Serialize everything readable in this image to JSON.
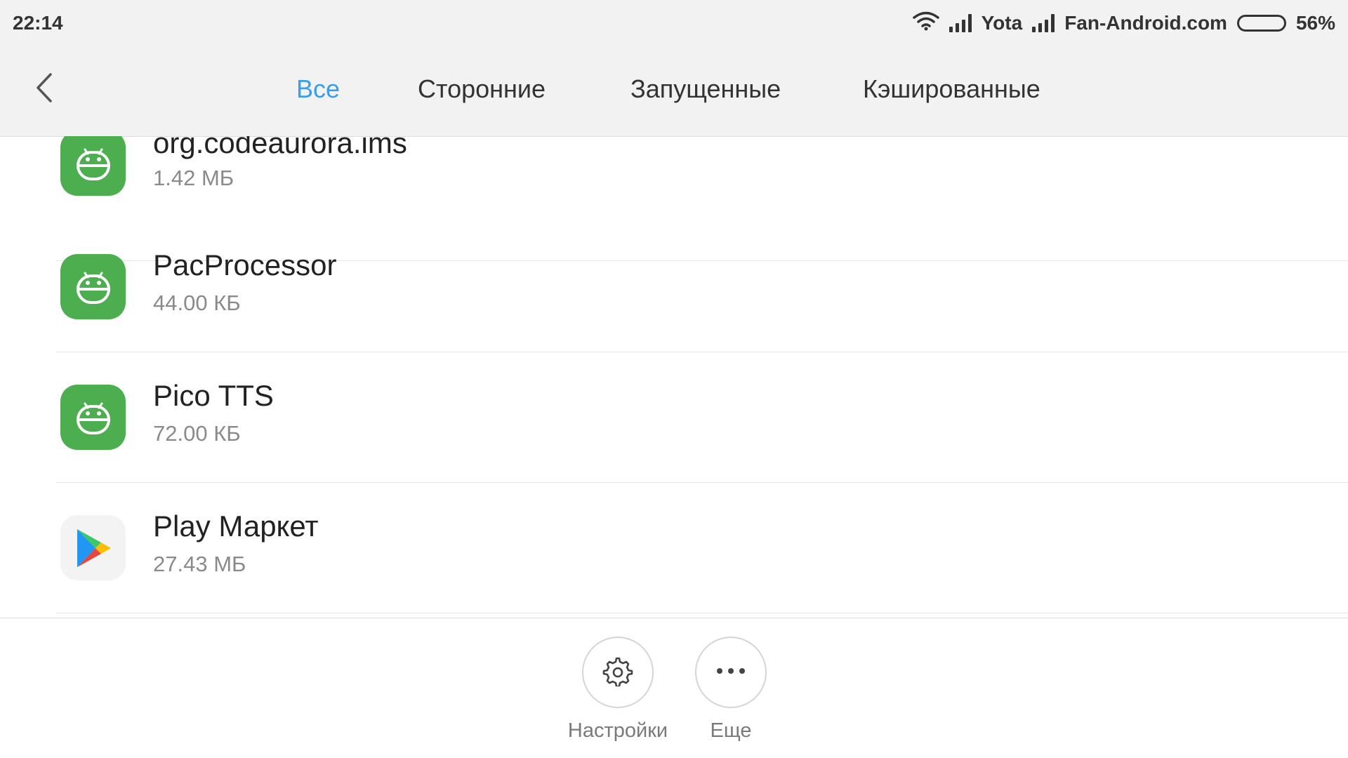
{
  "status_bar": {
    "time": "22:14",
    "carrier1": "Yota",
    "carrier2": "Fan-Android.com",
    "battery_percent": "56%",
    "battery_level": 0.56,
    "icons": [
      "wifi-icon",
      "signal-icon",
      "battery-icon"
    ]
  },
  "nav": {
    "back_icon": "chevron-left-icon",
    "tabs": [
      {
        "label": "Все",
        "active": true
      },
      {
        "label": "Сторонние",
        "active": false
      },
      {
        "label": "Запущенные",
        "active": false
      },
      {
        "label": "Кэшированные",
        "active": false
      }
    ]
  },
  "apps": [
    {
      "name": "org.codeaurora.ims",
      "size": "1.42 МБ",
      "icon": "android-icon"
    },
    {
      "name": "PacProcessor",
      "size": "44.00 КБ",
      "icon": "android-icon"
    },
    {
      "name": "Pico TTS",
      "size": "72.00 КБ",
      "icon": "android-icon"
    },
    {
      "name": "Play Маркет",
      "size": "27.43 МБ",
      "icon": "play-store-icon"
    }
  ],
  "bottom_actions": [
    {
      "label": "Настройки",
      "icon": "gear-icon"
    },
    {
      "label": "Еще",
      "icon": "more-icon"
    }
  ],
  "colors": {
    "accent": "#3a9ee8",
    "android_green": "#4cae4f",
    "header_bg": "#f2f2f2"
  }
}
